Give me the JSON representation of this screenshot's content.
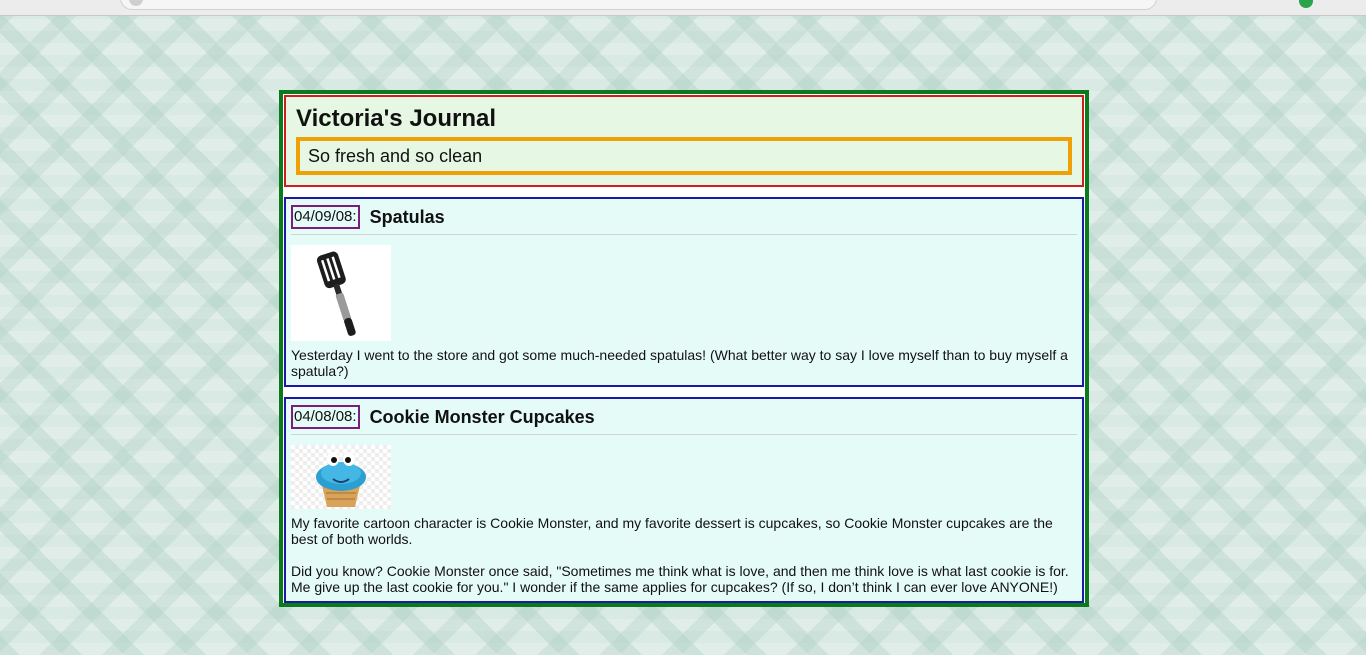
{
  "journal": {
    "title": "Victoria's Journal",
    "tagline": "So fresh and so clean"
  },
  "entries": [
    {
      "date": "04/09/08:",
      "title": "Spatulas",
      "image": "spatula-image",
      "paragraphs": [
        "Yesterday I went to the store and got some much-needed spatulas! (What better way to say I love myself than to buy myself a spatula?)"
      ]
    },
    {
      "date": "04/08/08:",
      "title": "Cookie Monster Cupcakes",
      "image": "cookie-monster-cupcake-image",
      "paragraphs": [
        "My favorite cartoon character is Cookie Monster, and my favorite dessert is cupcakes, so Cookie Monster cupcakes are the best of both worlds.",
        "Did you know? Cookie Monster once said, \"Sometimes me think what is love, and then me think love is what last cookie is for. Me give up the last cookie for you.\" I wonder if the same applies for cupcakes? (If so, I don’t think I can ever love ANYONE!)"
      ]
    }
  ],
  "colors": {
    "outer_border": "#0b7a1c",
    "header_border": "#cc1f1f",
    "tagline_border": "#f0a007",
    "entry_border": "#1a1aa6",
    "date_border": "#7b1e7b"
  }
}
